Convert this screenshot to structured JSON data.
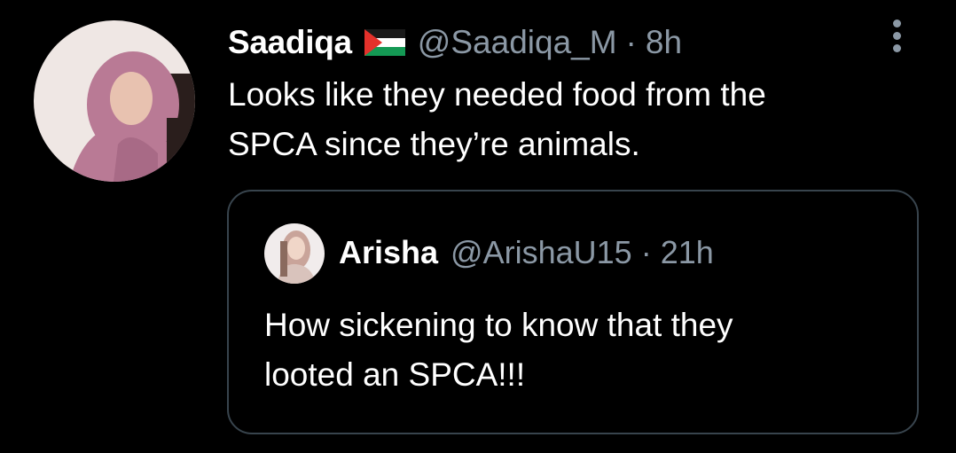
{
  "tweet": {
    "display_name": "Saadiqa",
    "handle": "@Saadiqa_M",
    "separator": "·",
    "time": "8h",
    "text": "Looks like they needed food from the\nSPCA since they’re animals.",
    "avatar_icon": "profile-photo",
    "flag_icon": "palestine-flag-emoji",
    "more_icon": "vertical-ellipsis-icon"
  },
  "quoted_tweet": {
    "display_name": "Arisha",
    "handle": "@ArishaU15",
    "separator": "·",
    "time": "21h",
    "text": "How sickening to know that they\nlooted an SPCA!!!",
    "avatar_icon": "profile-photo"
  },
  "colors": {
    "background": "#000000",
    "primary_text": "#ffffff",
    "secondary_text": "#8b98a5",
    "quote_border": "#38444d"
  }
}
